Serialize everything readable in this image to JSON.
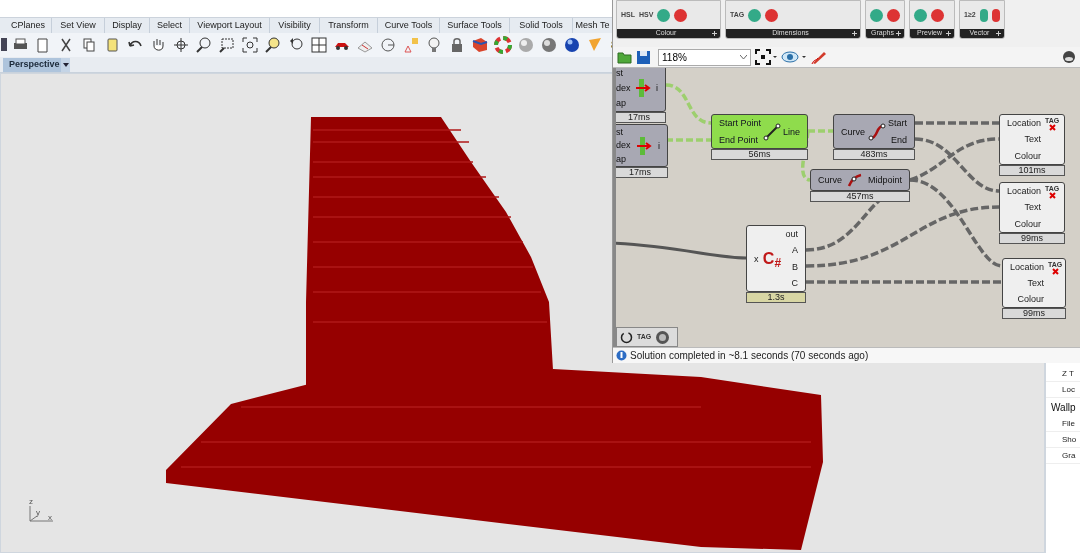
{
  "rhino": {
    "tabs": [
      {
        "label": "CPlanes"
      },
      {
        "label": "Set View"
      },
      {
        "label": "Display"
      },
      {
        "label": "Select"
      },
      {
        "label": "Viewport Layout"
      },
      {
        "label": "Visibility"
      },
      {
        "label": "Transform"
      },
      {
        "label": "Curve Tools"
      },
      {
        "label": "Surface Tools"
      },
      {
        "label": "Solid Tools"
      },
      {
        "label": "Mesh Te"
      }
    ],
    "viewport": {
      "title": "Perspective",
      "axis_labels": [
        "z",
        "y",
        "x"
      ]
    },
    "properties": [
      {
        "kind": "row",
        "label": "Z T"
      },
      {
        "kind": "row",
        "label": "Loc"
      },
      {
        "kind": "header",
        "label": "Wallp"
      },
      {
        "kind": "row",
        "label": "File"
      },
      {
        "kind": "row",
        "label": "Sho"
      },
      {
        "kind": "row",
        "label": "Gra"
      }
    ]
  },
  "grasshopper": {
    "ribbon_groups": [
      {
        "label": "Colour",
        "icon_labels": [
          "HSL",
          "HSV"
        ]
      },
      {
        "label": "Dimensions",
        "icon_labels": [
          "TAG"
        ]
      },
      {
        "label": "Graphs"
      },
      {
        "label": "Preview"
      },
      {
        "label": "Vector",
        "icon_labels": [
          "1≥2"
        ]
      }
    ],
    "zoom": "118%",
    "components": [
      {
        "kind": "list",
        "selected": false,
        "title": "st",
        "inputs": [
          "dex",
          "ap"
        ],
        "outputs": [
          "i"
        ],
        "footer": "17ms"
      },
      {
        "kind": "list",
        "selected": false,
        "title": "st",
        "inputs": [
          "dex",
          "ap"
        ],
        "outputs": [
          "i"
        ],
        "footer": "17ms"
      },
      {
        "kind": "line",
        "selected": true,
        "inputs": [
          "Start Point",
          "End Point"
        ],
        "outputs": [
          "Line"
        ],
        "footer": "56ms"
      },
      {
        "kind": "curve",
        "selected": false,
        "inputs": [
          "Curve"
        ],
        "outputs": [
          "Start",
          "End"
        ],
        "footer": "483ms"
      },
      {
        "kind": "midpoint",
        "selected": false,
        "inputs": [
          "Curve"
        ],
        "outputs": [
          "Midpoint"
        ],
        "footer": "457ms"
      },
      {
        "kind": "tag",
        "selected": false,
        "icon_text": "TAG",
        "inputs": [
          "Location",
          "Text",
          "Colour"
        ],
        "footer": "101ms"
      },
      {
        "kind": "tag",
        "selected": false,
        "icon_text": "TAG",
        "inputs": [
          "Location",
          "Text",
          "Colour"
        ],
        "footer": "99ms"
      },
      {
        "kind": "script",
        "selected": false,
        "icon_text": "C$_{#}$",
        "inputs": [
          "x"
        ],
        "outputs": [
          "out",
          "A",
          "B",
          "C"
        ],
        "footer": "1.3s"
      },
      {
        "kind": "tag",
        "selected": false,
        "icon_text": "TAG",
        "inputs": [
          "Location",
          "Text",
          "Colour"
        ],
        "footer": "99ms"
      }
    ],
    "mini_toolbar": {
      "icon_text": "TAG"
    },
    "status": "Solution completed in ~8.1 seconds (70 seconds ago)"
  }
}
